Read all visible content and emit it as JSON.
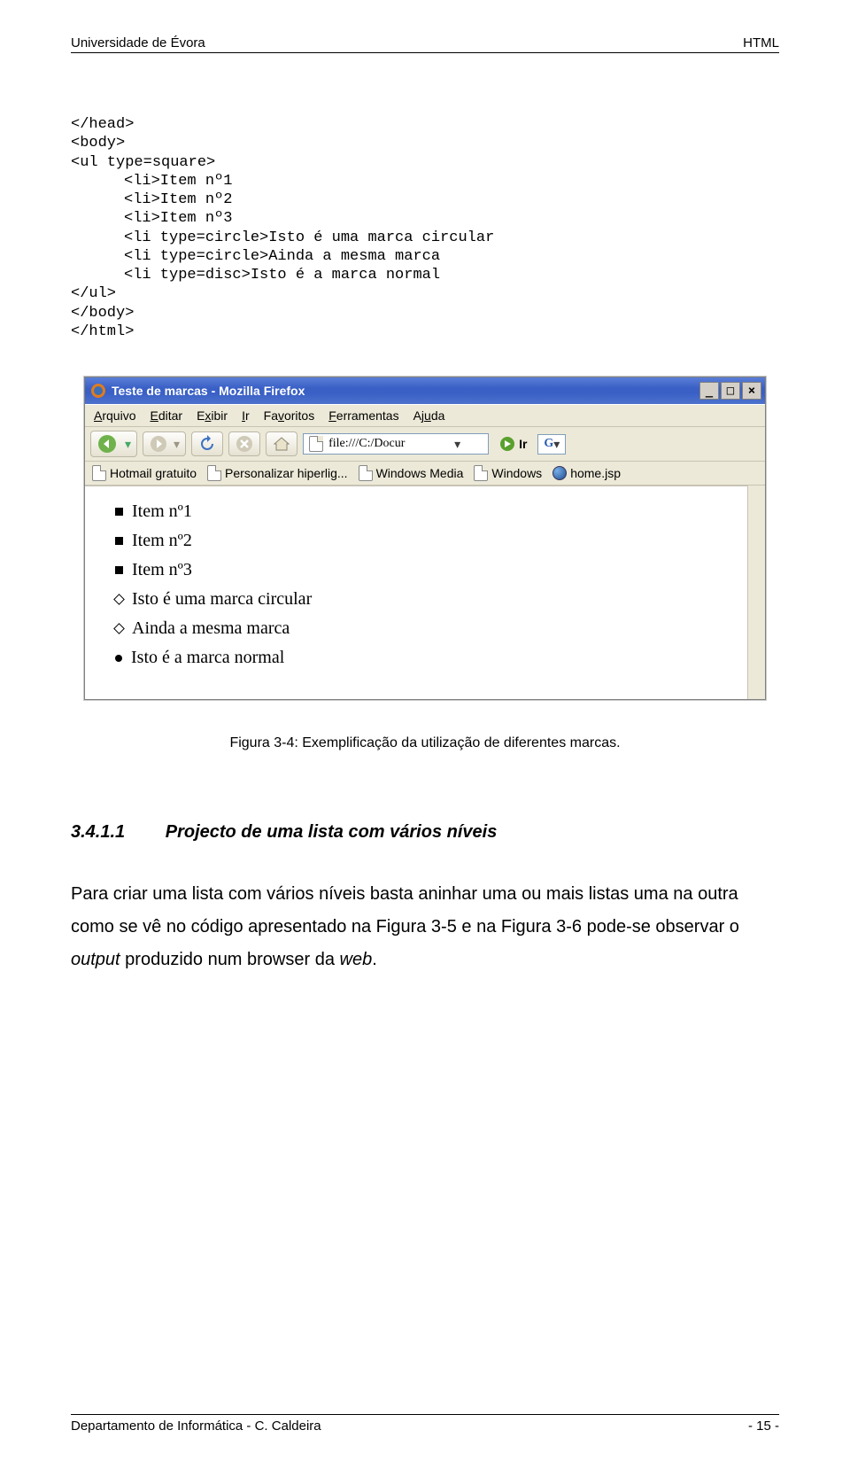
{
  "header": {
    "left": "Universidade de Évora",
    "right": "HTML"
  },
  "code": {
    "l1": "</head>",
    "l2": "<body>",
    "l3": "<ul type=square>",
    "l4": "<li>Item nº1",
    "l5": "<li>Item nº2",
    "l6": "<li>Item nº3",
    "l7": "<li type=circle>Isto é uma marca circular",
    "l8": "<li type=circle>Ainda a mesma marca",
    "l9": "<li type=disc>Isto é a marca normal",
    "l10": "</ul>",
    "l11": "</body>",
    "l12": "</html>"
  },
  "browser": {
    "title": "Teste de marcas - Mozilla Firefox",
    "menus": {
      "m1": "Arquivo",
      "m2": "Editar",
      "m3": "Exibir",
      "m4": "Ir",
      "m5": "Favoritos",
      "m6": "Ferramentas",
      "m7": "Ajuda"
    },
    "address_value": "file:///C:/Docur",
    "go_label": "Ir",
    "bookmarks": {
      "b1": "Hotmail gratuito",
      "b2": "Personalizar hiperlig...",
      "b3": "Windows Media",
      "b4": "Windows",
      "b5": "home.jsp"
    },
    "items": {
      "i1": "Item nº1",
      "i2": "Item nº2",
      "i3": "Item nº3",
      "i4": "Isto é uma marca circular",
      "i5": "Ainda a mesma marca",
      "i6": "Isto é a marca normal"
    }
  },
  "caption": "Figura 3-4: Exemplificação da utilização de diferentes marcas.",
  "section": {
    "number": "3.4.1.1",
    "title": "Projecto de uma lista com vários níveis"
  },
  "paragraph": "Para criar uma lista com vários níveis basta aninhar uma ou mais listas uma na outra como se vê no código apresentado na Figura 3-5 e na Figura 3-6 pode-se observar o output produzido num browser da web.",
  "footer": {
    "left": "Departamento de Informática - C. Caldeira",
    "right": "- 15 -"
  }
}
